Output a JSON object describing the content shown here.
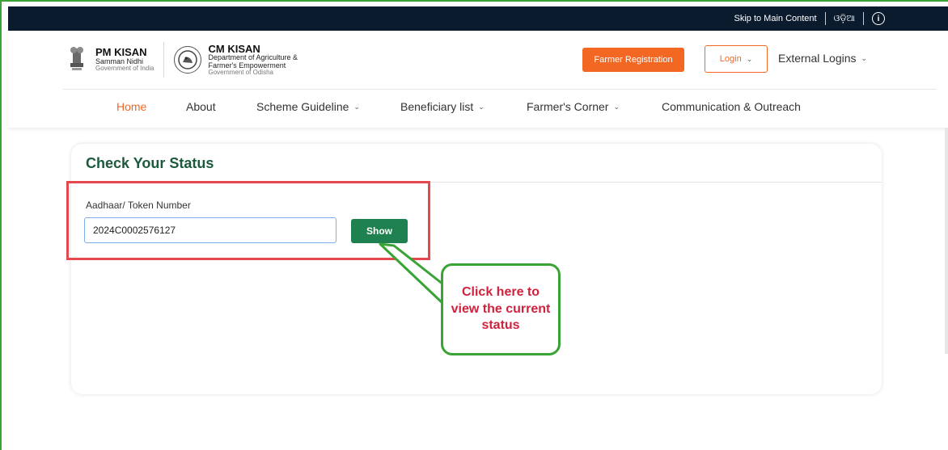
{
  "topbar": {
    "skip_link": "Skip to Main Content",
    "language": "ଓଡ଼ିଆ",
    "accessibility_icon": "accessibility-icon"
  },
  "header": {
    "pm_kisan": {
      "title": "PM KISAN",
      "subtitle": "Samman Nidhi",
      "org": "Government of India"
    },
    "cm_kisan": {
      "title": "CM KISAN",
      "line1": "Department of Agriculture &",
      "line2": "Farmer's Empowerment",
      "org": "Government of Odisha"
    },
    "farmer_registration": "Farmer Registration",
    "login": "Login",
    "external_logins": "External Logins"
  },
  "nav": {
    "items": [
      {
        "label": "Home"
      },
      {
        "label": "About"
      },
      {
        "label": "Scheme Guideline"
      },
      {
        "label": "Beneficiary list"
      },
      {
        "label": "Farmer's Corner"
      },
      {
        "label": "Communication & Outreach"
      }
    ]
  },
  "status_card": {
    "title": "Check Your Status",
    "field_label": "Aadhaar/ Token Number",
    "field_value": "2024C0002576127",
    "show_button": "Show"
  },
  "callout": {
    "text": "Click here to view the current status"
  },
  "colors": {
    "accent_orange": "#f26722",
    "dark_green": "#1c5a3c",
    "button_green": "#1f8050",
    "highlight_red": "#e5484d",
    "callout_green": "#3aa335",
    "callout_text": "#d0213d",
    "topbar_bg": "#0b1b2e"
  }
}
